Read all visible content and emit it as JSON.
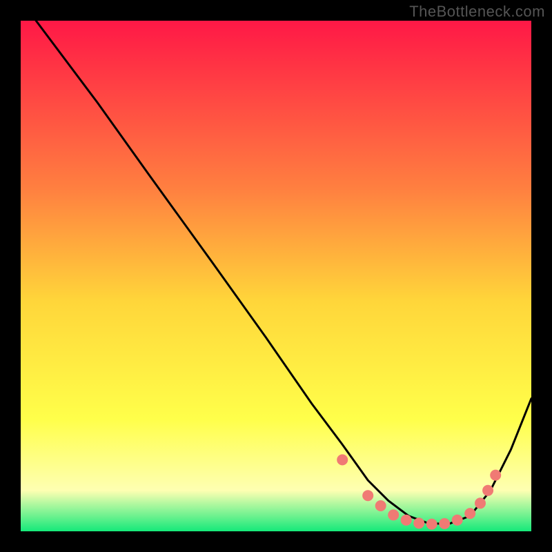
{
  "watermark": "TheBottleneck.com",
  "colors": {
    "black": "#000000",
    "curve": "#000000",
    "marker_fill": "#f07a74",
    "grad_top": "#ff1846",
    "grad_mid_upper": "#ff8040",
    "grad_mid": "#ffd63a",
    "grad_mid_lower": "#ffff4a",
    "grad_pale": "#feffb2",
    "grad_green": "#15e97a"
  },
  "chart_data": {
    "type": "line",
    "title": "",
    "xlabel": "",
    "ylabel": "",
    "xlim": [
      0,
      100
    ],
    "ylim": [
      0,
      100
    ],
    "series": [
      {
        "name": "curve",
        "x": [
          3,
          15,
          25,
          38,
          48,
          57,
          63,
          68,
          72,
          76,
          80,
          84,
          88,
          92,
          96,
          100
        ],
        "y": [
          100,
          84,
          70,
          52,
          38,
          25,
          17,
          10,
          6,
          3,
          1.5,
          1.5,
          3,
          8,
          16,
          26
        ]
      }
    ],
    "markers": {
      "name": "highlight-points",
      "x": [
        63,
        68,
        70.5,
        73,
        75.5,
        78,
        80.5,
        83,
        85.5,
        88,
        90,
        91.5,
        93
      ],
      "y": [
        14,
        7,
        5,
        3.2,
        2.2,
        1.6,
        1.4,
        1.5,
        2.2,
        3.5,
        5.5,
        8,
        11
      ]
    }
  }
}
